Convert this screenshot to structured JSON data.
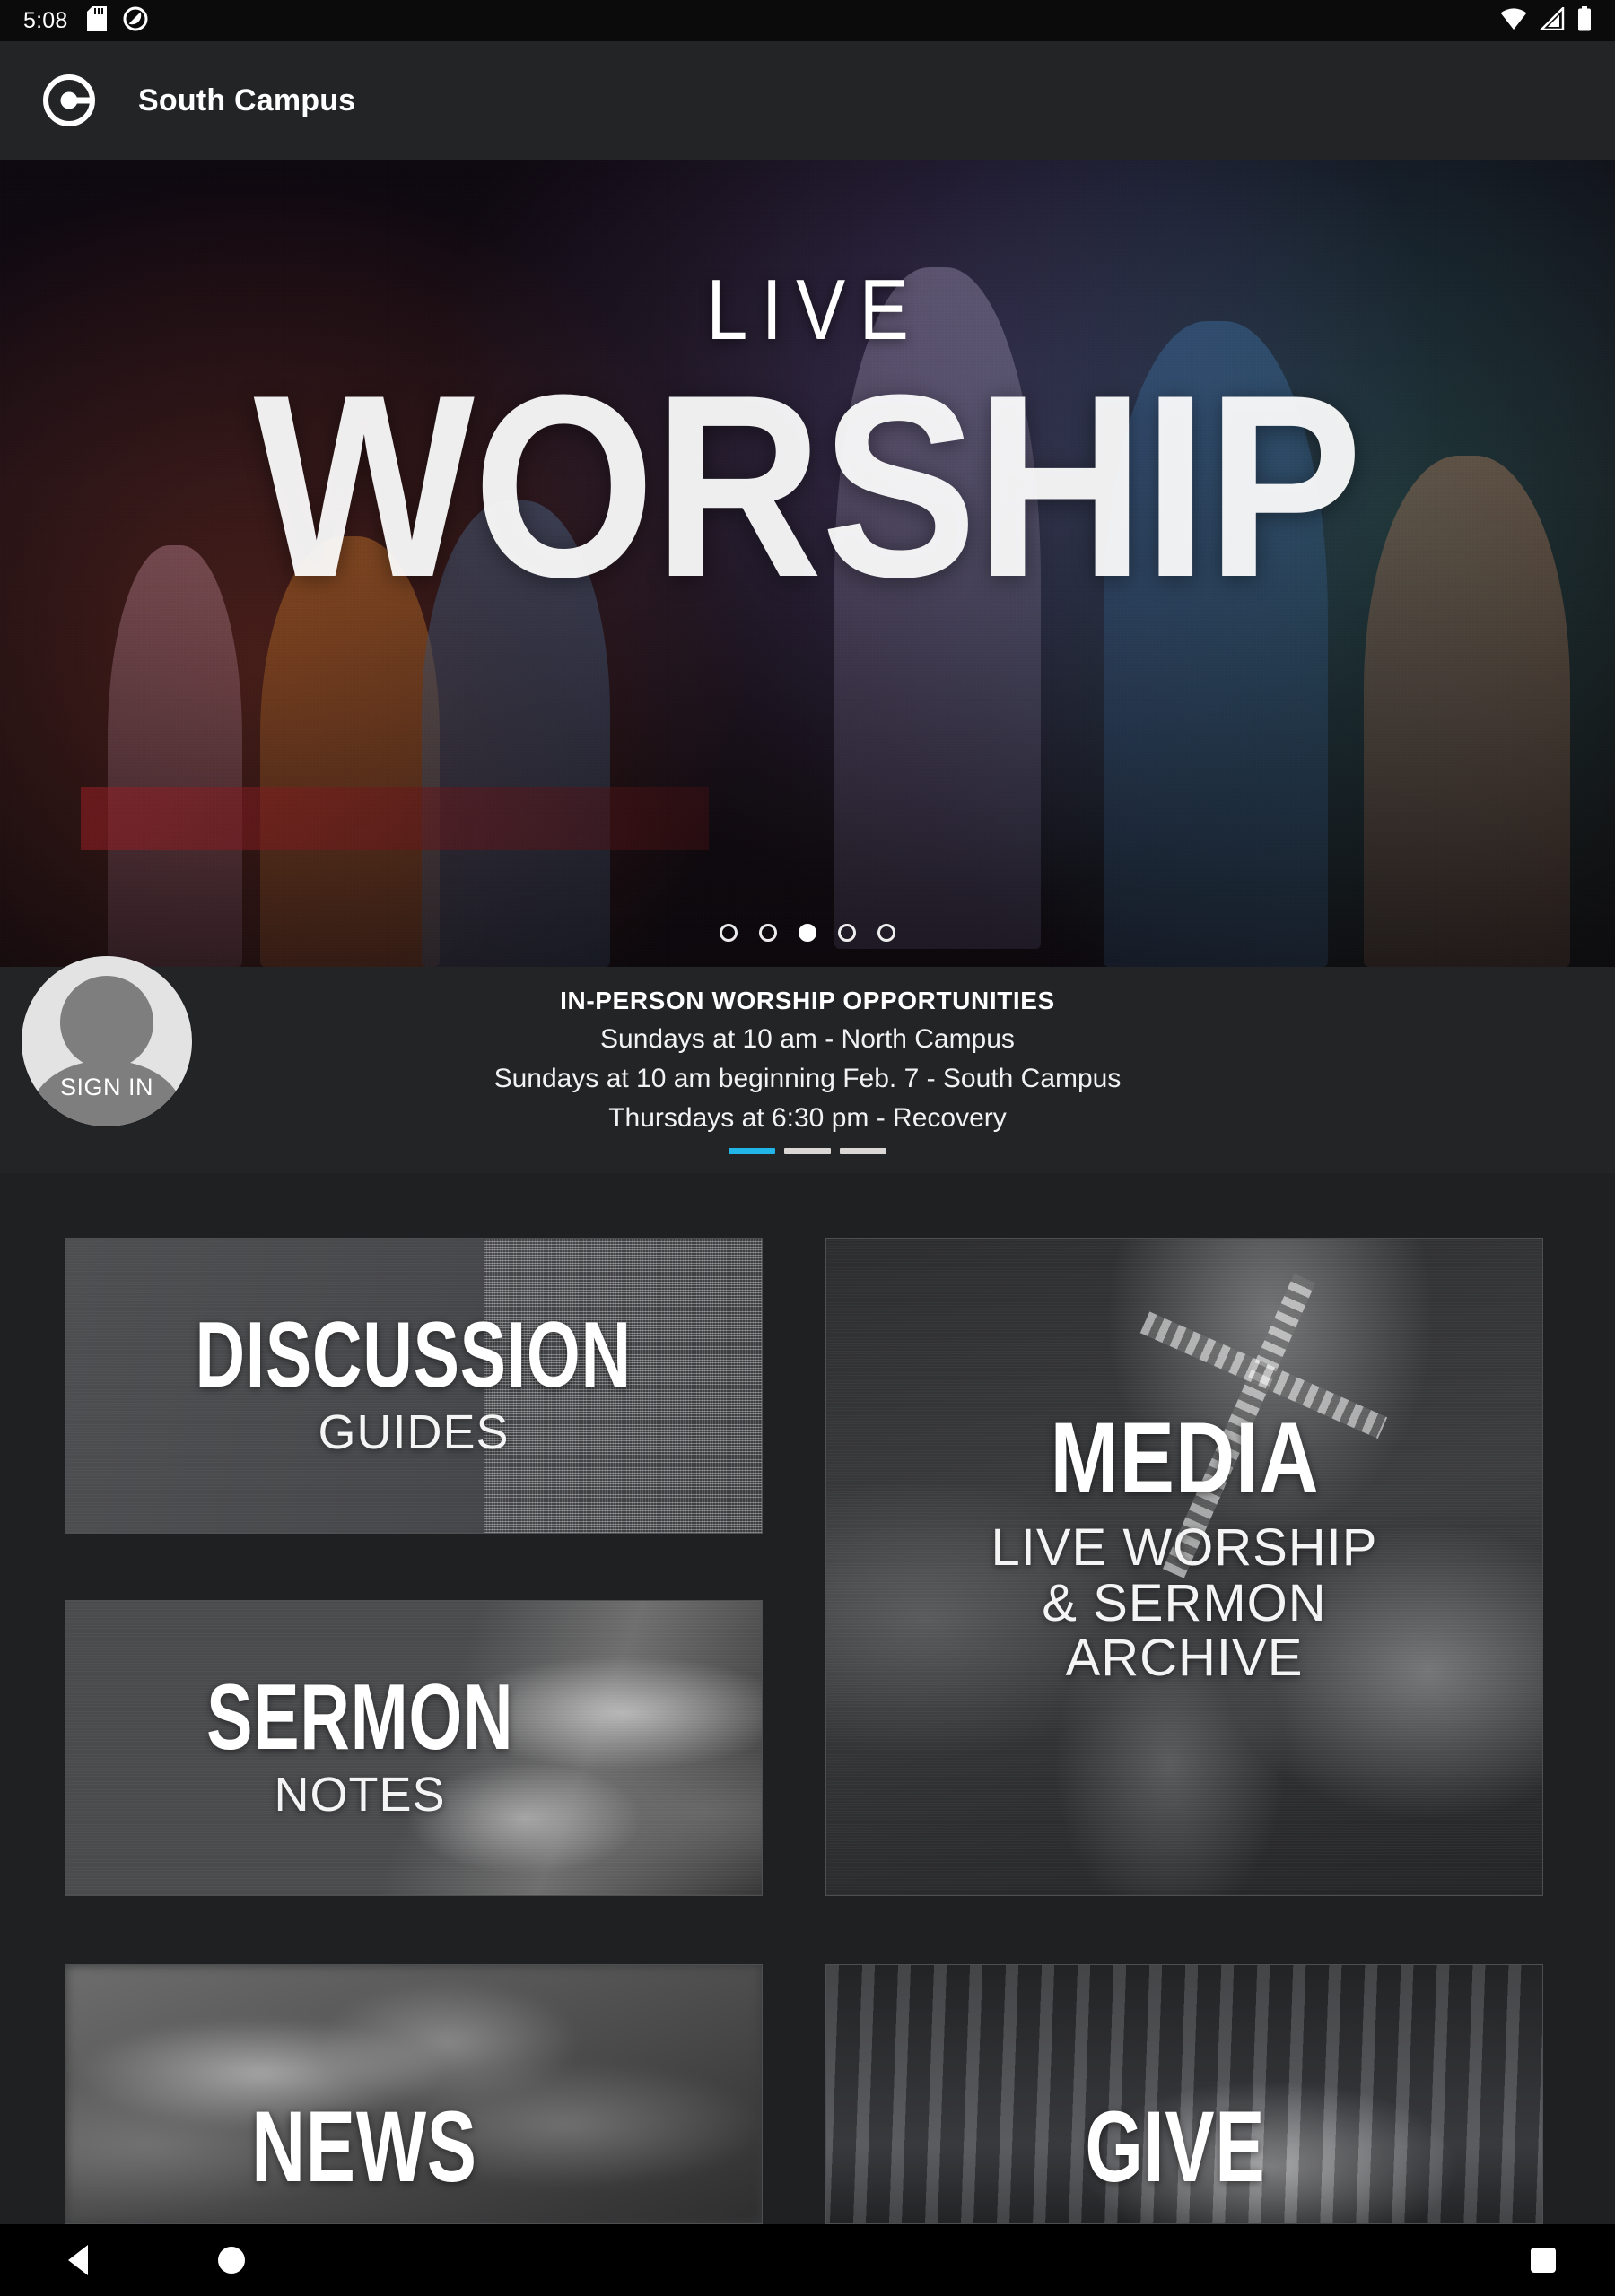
{
  "status_bar": {
    "time": "5:08",
    "left_icons": [
      "sd-card-icon",
      "do-not-disturb-icon"
    ],
    "right_icons": [
      "wifi-icon",
      "cellular-signal-icon",
      "battery-icon"
    ]
  },
  "app_bar": {
    "logo_icon": "church-circle-logo-icon",
    "title": "South Campus"
  },
  "hero": {
    "line1": "LIVE",
    "line2": "WORSHIP",
    "dots_total": 5,
    "active_dot": 3
  },
  "announcement": {
    "title": "IN-PERSON WORSHIP OPPORTUNITIES",
    "lines": [
      "Sundays at 10 am - North Campus",
      "Sundays at 10 am beginning Feb. 7 - South Campus",
      "Thursdays at 6:30 pm - Recovery"
    ],
    "bars_total": 3,
    "active_bar": 1,
    "active_bar_color": "#22b6e8",
    "inactive_bar_color": "#dad7d4"
  },
  "account": {
    "avatar_icon": "person-avatar-icon",
    "sign_in_label": "SIGN IN"
  },
  "cards": [
    {
      "id": "discussion",
      "title": "DISCUSSION",
      "subtitle": "GUIDES"
    },
    {
      "id": "media",
      "title": "MEDIA",
      "subtitle": "LIVE WORSHIP\n& SERMON\nARCHIVE"
    },
    {
      "id": "sermon",
      "title": "SERMON",
      "subtitle": "NOTES"
    },
    {
      "id": "news",
      "title": "NEWS",
      "subtitle": ""
    },
    {
      "id": "give",
      "title": "GIVE",
      "subtitle": ""
    }
  ],
  "nav_bar": {
    "back_icon": "back-triangle-icon",
    "home_icon": "home-circle-icon",
    "recents_icon": "recents-square-icon"
  },
  "theme": {
    "background": "#1f2022",
    "surface": "#232426",
    "accent": "#22b6e8"
  }
}
